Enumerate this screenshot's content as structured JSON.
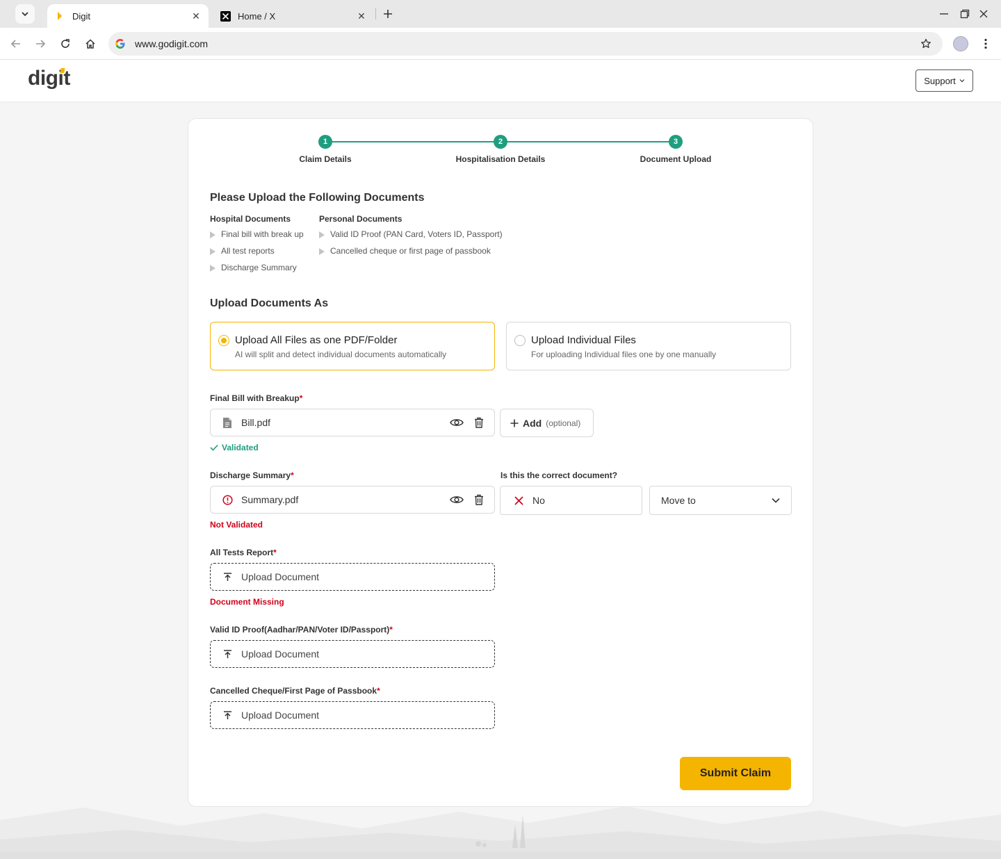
{
  "browser": {
    "tabs": [
      {
        "title": "Digit",
        "active": true
      },
      {
        "title": "Home / X",
        "active": false
      }
    ],
    "close_glyph": "✕",
    "url": "www.godigit.com"
  },
  "site": {
    "logo": "digit",
    "support_label": "Support"
  },
  "stepper": {
    "steps": [
      {
        "number": "1",
        "label": "Claim Details"
      },
      {
        "number": "2",
        "label": "Hospitalisation Details"
      },
      {
        "number": "3",
        "label": "Document Upload"
      }
    ],
    "color": "#1f9e7f"
  },
  "documents": {
    "heading": "Please Upload the Following Documents",
    "hospital": {
      "heading": "Hospital Documents",
      "items": [
        "Final bill with break up",
        "All test reports",
        "Discharge Summary"
      ]
    },
    "personal": {
      "heading": "Personal Documents",
      "items": [
        "Valid ID Proof (PAN Card, Voters ID, Passport)",
        "Cancelled cheque or first page of passbook"
      ]
    }
  },
  "upload_as": {
    "heading": "Upload Documents As",
    "options": [
      {
        "title": "Upload All Files as one PDF/Folder",
        "subtitle": "AI will split and detect individual documents automatically",
        "selected": true
      },
      {
        "title": "Upload Individual Files",
        "subtitle": "For uploading Individual files one by one manually",
        "selected": false
      }
    ]
  },
  "fields": {
    "final_bill": {
      "label": "Final Bill with Breakup",
      "required": "*",
      "file": "Bill.pdf",
      "status": "Validated",
      "add_label": "Add",
      "add_optional": "(optional)"
    },
    "discharge": {
      "label": "Discharge Summary",
      "required": "*",
      "file": "Summary.pdf",
      "status": "Not Validated",
      "question": "Is this the correct document?",
      "answer": "No",
      "move_to": "Move to"
    },
    "tests": {
      "label": "All Tests Report",
      "required": "*",
      "upload": "Upload Document",
      "status": "Document Missing"
    },
    "id_proof": {
      "label": "Valid ID Proof(Aadhar/PAN/Voter ID/Passport)",
      "required": "*",
      "upload": "Upload Document"
    },
    "cheque": {
      "label": "Cancelled Cheque/First Page of Passbook",
      "required": "*",
      "upload": "Upload Document"
    }
  },
  "submit_label": "Submit Claim",
  "colors": {
    "accent": "#f5b400",
    "success": "#1f9e7f",
    "error": "#d0021b"
  }
}
